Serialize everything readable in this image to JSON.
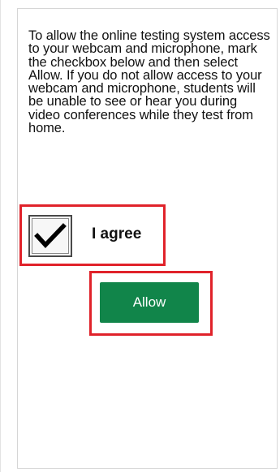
{
  "dialog": {
    "notice_text": "To allow the online testing system access to your webcam and microphone, mark the checkbox below and then select Allow. If you do not allow access to your webcam and microphone, students will be unable to see or hear you during video conferences while they test from home.",
    "agree_checkbox": {
      "checked": true,
      "label": "I agree"
    },
    "allow_button_label": "Allow"
  },
  "colors": {
    "allow_button": "#11854a",
    "highlight_outline": "#e0222a",
    "text": "#111111"
  },
  "icons": {
    "checkmark": "checkmark-icon"
  }
}
